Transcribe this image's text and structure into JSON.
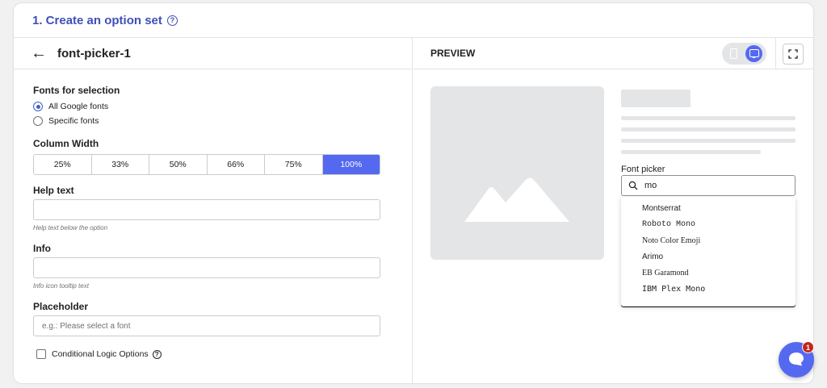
{
  "header": {
    "title": "1. Create an option set",
    "help_icon": "question-circle-icon"
  },
  "option": {
    "back_icon": "arrow-left-icon",
    "name": "font-picker-1"
  },
  "fonts_for_selection": {
    "label": "Fonts for selection",
    "options": [
      {
        "label": "All Google fonts",
        "selected": true
      },
      {
        "label": "Specific fonts",
        "selected": false
      }
    ]
  },
  "column_width": {
    "label": "Column Width",
    "options": [
      "25%",
      "33%",
      "50%",
      "66%",
      "75%",
      "100%"
    ],
    "selected": "100%"
  },
  "help_text": {
    "label": "Help text",
    "value": "",
    "hint": "Help text below the option"
  },
  "info": {
    "label": "Info",
    "value": "",
    "hint": "Info icon tooltip text"
  },
  "placeholder": {
    "label": "Placeholder",
    "placeholder": "e.g.: Please select a font"
  },
  "conditional": {
    "label": "Conditional Logic Options",
    "checked": false
  },
  "preview": {
    "label": "PREVIEW",
    "device": "desktop",
    "font_picker_label": "Font picker",
    "search_value": "mo",
    "results": [
      "Montserrat",
      "Roboto Mono",
      "Noto Color Emoji",
      "Arimo",
      "EB Garamond",
      "IBM Plex Mono"
    ]
  },
  "chat": {
    "badge": "1",
    "icon": "chat-bubble-icon"
  },
  "colors": {
    "accent": "#5569f0",
    "title": "#3f4fb8",
    "badge": "#c2261d"
  }
}
